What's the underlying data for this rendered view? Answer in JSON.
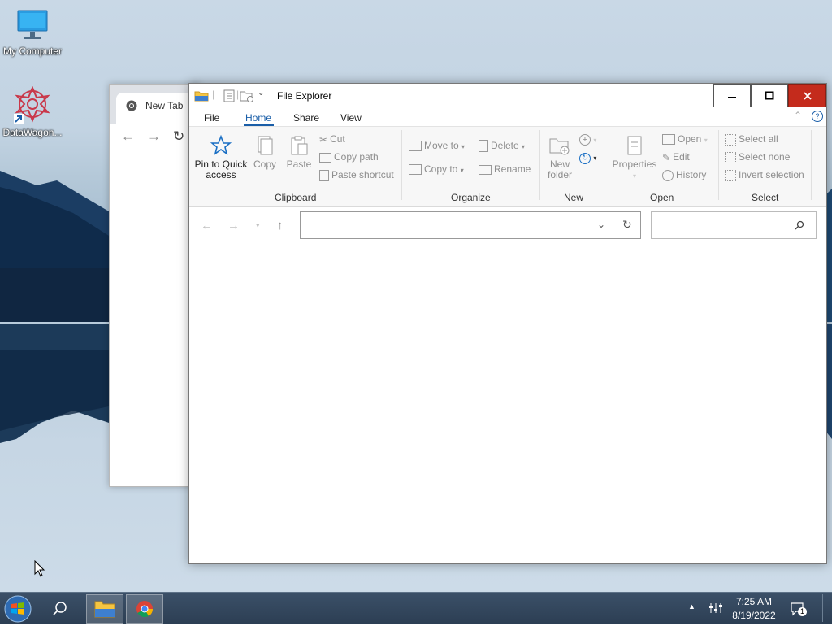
{
  "desktop": {
    "icons": [
      {
        "label": "My Computer",
        "icon": "monitor-icon"
      },
      {
        "label": "DataWagon...",
        "icon": "datawagon-icon"
      }
    ]
  },
  "chrome_window": {
    "tab_title": "New Tab"
  },
  "explorer": {
    "title": "File Explorer",
    "menu": {
      "file": "File",
      "home": "Home",
      "share": "Share",
      "view": "View"
    },
    "ribbon": {
      "clipboard": {
        "group_label": "Clipboard",
        "pin_line1": "Pin to Quick",
        "pin_line2": "access",
        "copy": "Copy",
        "paste": "Paste",
        "cut": "Cut",
        "copy_path": "Copy path",
        "paste_shortcut": "Paste shortcut"
      },
      "organize": {
        "group_label": "Organize",
        "move_to": "Move to",
        "copy_to": "Copy to",
        "delete": "Delete",
        "rename": "Rename"
      },
      "new": {
        "group_label": "New",
        "new_folder_line1": "New",
        "new_folder_line2": "folder"
      },
      "open": {
        "group_label": "Open",
        "properties": "Properties",
        "open": "Open",
        "edit": "Edit",
        "history": "History"
      },
      "select": {
        "group_label": "Select",
        "select_all": "Select all",
        "select_none": "Select none",
        "invert_selection": "Invert selection"
      }
    },
    "address_value": "",
    "search_value": ""
  },
  "taskbar": {
    "time": "7:25 AM",
    "date": "8/19/2022",
    "notification_count": "1"
  },
  "colors": {
    "accent": "#1a5ea8",
    "close": "#c42b1c",
    "taskbar": "#2c3e53"
  }
}
